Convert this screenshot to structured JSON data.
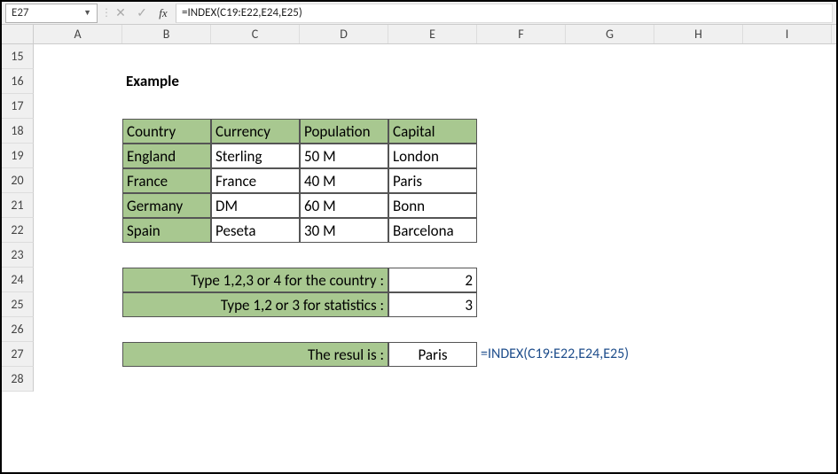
{
  "formula_bar": {
    "cell_ref": "E27",
    "fx_label": "fx",
    "formula": "=INDEX(C19:E22,E24,E25)"
  },
  "columns": [
    "A",
    "B",
    "C",
    "D",
    "E",
    "F",
    "G",
    "H",
    "I"
  ],
  "rows": [
    "15",
    "16",
    "17",
    "18",
    "19",
    "20",
    "21",
    "22",
    "23",
    "24",
    "25",
    "26",
    "27",
    "28"
  ],
  "example_label": "Example",
  "table": {
    "headers": [
      "Country",
      "Currency",
      "Population",
      "Capital"
    ],
    "rows": [
      [
        "England",
        "Sterling",
        "50 M",
        "London"
      ],
      [
        "France",
        "France",
        "40 M",
        "Paris"
      ],
      [
        "Germany",
        "DM",
        "60 M",
        "Bonn"
      ],
      [
        "Spain",
        "Peseta",
        "30 M",
        "Barcelona"
      ]
    ]
  },
  "inputs": {
    "row_label": "Type 1,2,3 or 4 for the country :",
    "row_value": "2",
    "col_label": "Type 1,2 or 3 for statistics :",
    "col_value": "3"
  },
  "result": {
    "label": "The resul is :",
    "value": "Paris",
    "formula_display": "=INDEX(C19:E22,E24,E25)"
  },
  "chart_data": {
    "type": "table",
    "title": "Example",
    "headers": [
      "Country",
      "Currency",
      "Population",
      "Capital"
    ],
    "rows": [
      [
        "England",
        "Sterling",
        "50 M",
        "London"
      ],
      [
        "France",
        "France",
        "40 M",
        "Paris"
      ],
      [
        "Germany",
        "DM",
        "60 M",
        "Bonn"
      ],
      [
        "Spain",
        "Peseta",
        "30 M",
        "Barcelona"
      ]
    ],
    "inputs": {
      "country_index": 2,
      "stat_index": 3
    },
    "result": "Paris",
    "formula": "=INDEX(C19:E22,E24,E25)"
  }
}
